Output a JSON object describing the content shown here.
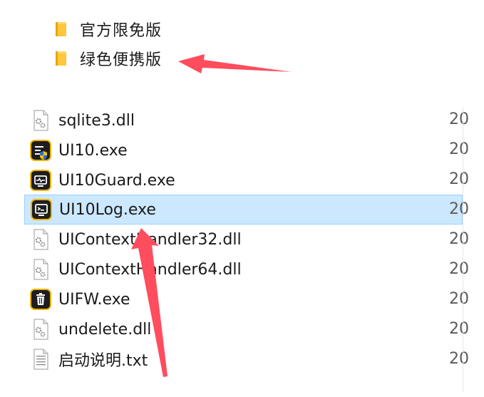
{
  "folders": [
    {
      "label": "官方限免版",
      "icon": "folder-icon"
    },
    {
      "label": "绿色便携版",
      "icon": "folder-icon"
    }
  ],
  "files": [
    {
      "name": "sqlite3.dll",
      "date": "20",
      "icon": "dll-gear-icon",
      "selected": false
    },
    {
      "name": "UI10.exe",
      "date": "20",
      "icon": "ui10-app-icon",
      "selected": false
    },
    {
      "name": "UI10Guard.exe",
      "date": "20",
      "icon": "ui10guard-app-icon",
      "selected": false
    },
    {
      "name": "UI10Log.exe",
      "date": "20",
      "icon": "ui10log-app-icon",
      "selected": true
    },
    {
      "name": "UIContextHandler32.dll",
      "date": "20",
      "icon": "dll-gear-icon",
      "selected": false
    },
    {
      "name": "UIContextHandler64.dll",
      "date": "20",
      "icon": "dll-gear-icon",
      "selected": false
    },
    {
      "name": "UIFW.exe",
      "date": "20",
      "icon": "trash-app-icon",
      "selected": false
    },
    {
      "name": "undelete.dll",
      "date": "20",
      "icon": "dll-gear-icon",
      "selected": false
    },
    {
      "name": "启动说明.txt",
      "date": "20",
      "icon": "text-file-icon",
      "selected": false
    }
  ],
  "colors": {
    "selection_bg": "#cce8ff",
    "selection_border": "#99d1ff",
    "annotation_arrow": "#ff4d5e",
    "folder_yellow": "#ffc83d",
    "app_icon_frame": "#f2b200"
  }
}
